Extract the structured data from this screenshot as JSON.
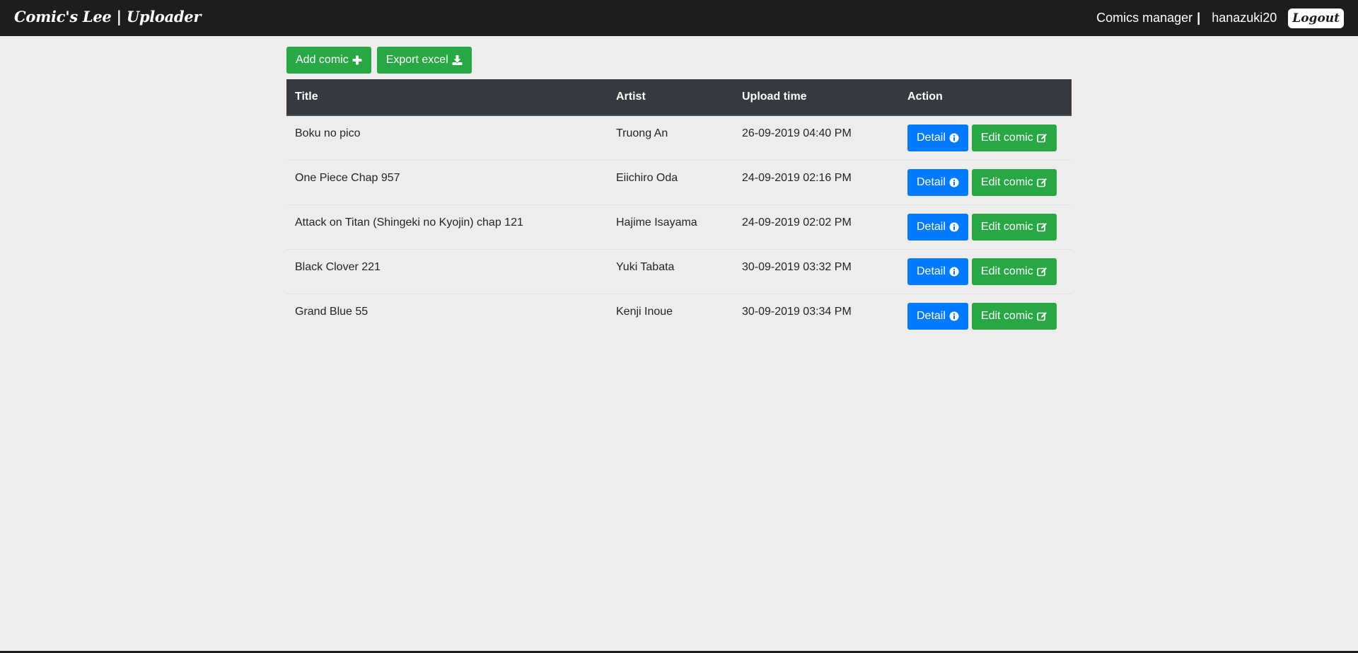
{
  "navbar": {
    "brand": "Comic's Lee | Uploader",
    "manager_link": "Comics manager",
    "separator": "|",
    "username": "hanazuki20",
    "logout_label": "Logout"
  },
  "toolbar": {
    "add_label": "Add comic",
    "add_icon": "plus-icon",
    "export_label": "Export excel",
    "export_icon": "download-icon"
  },
  "table": {
    "headers": [
      "Title",
      "Artist",
      "Upload time",
      "Action"
    ],
    "detail_label": "Detail",
    "detail_icon": "info-circle-icon",
    "edit_label": "Edit comic",
    "edit_icon": "edit-icon",
    "rows": [
      {
        "title": "Boku no pico",
        "artist": "Truong An",
        "upload_time": "26-09-2019 04:40 PM"
      },
      {
        "title": "One Piece Chap 957",
        "artist": "Eiichiro Oda",
        "upload_time": "24-09-2019 02:16 PM"
      },
      {
        "title": "Attack on Titan (Shingeki no Kyojin) chap 121",
        "artist": "Hajime Isayama",
        "upload_time": "24-09-2019 02:02 PM"
      },
      {
        "title": "Black Clover 221",
        "artist": "Yuki Tabata",
        "upload_time": "30-09-2019 03:32 PM"
      },
      {
        "title": "Grand Blue 55",
        "artist": "Kenji Inoue",
        "upload_time": "30-09-2019 03:34 PM"
      }
    ]
  },
  "colors": {
    "navbar_bg": "#1d1d1d",
    "page_bg": "#eeedeb",
    "header_bg": "#343a40",
    "green": "#28a745",
    "blue": "#007bff"
  }
}
